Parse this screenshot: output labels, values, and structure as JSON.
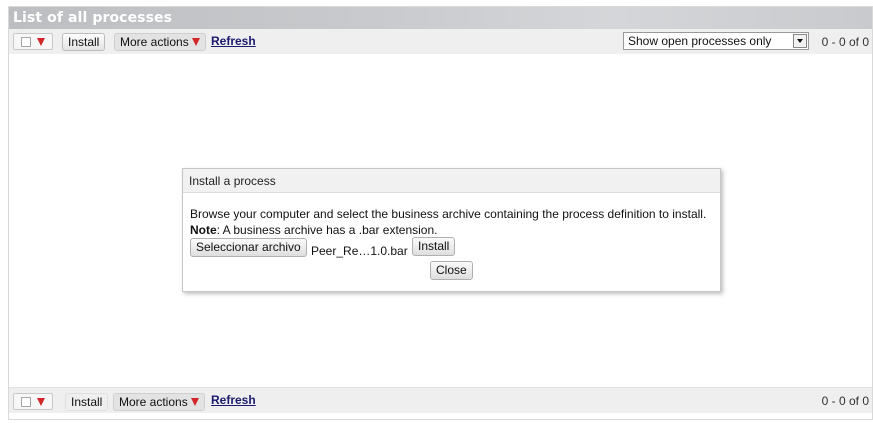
{
  "panel": {
    "title": "List of all processes"
  },
  "toolbar_top": {
    "install_label": "Install",
    "more_actions_label": "More actions",
    "refresh_label": "Refresh",
    "filter_value": "Show open processes only",
    "pager_text": "0 - 0 of 0"
  },
  "toolbar_bottom": {
    "install_label": "Install",
    "more_actions_label": "More actions",
    "refresh_label": "Refresh",
    "pager_text": "0 - 0 of 0"
  },
  "dialog": {
    "title": "Install a process",
    "description": "Browse your computer and select the business archive containing the process definition to install.",
    "note_label": "Note",
    "note_text": ": A business archive has a .bar extension.",
    "choose_file_label": "Seleccionar archivo",
    "file_name": "Peer_Re…1.0.bar",
    "install_label": "Install",
    "close_label": "Close"
  },
  "colors": {
    "title_bar": "#c3c5c8",
    "toolbar_bg": "#efefef",
    "accent_arrow": "#d2262b",
    "link": "#1a1a6e"
  },
  "icons": {
    "select_dropdown": "caret-down-icon",
    "more_actions": "caret-down-icon",
    "filter_dropdown": "chevron-down-icon"
  }
}
